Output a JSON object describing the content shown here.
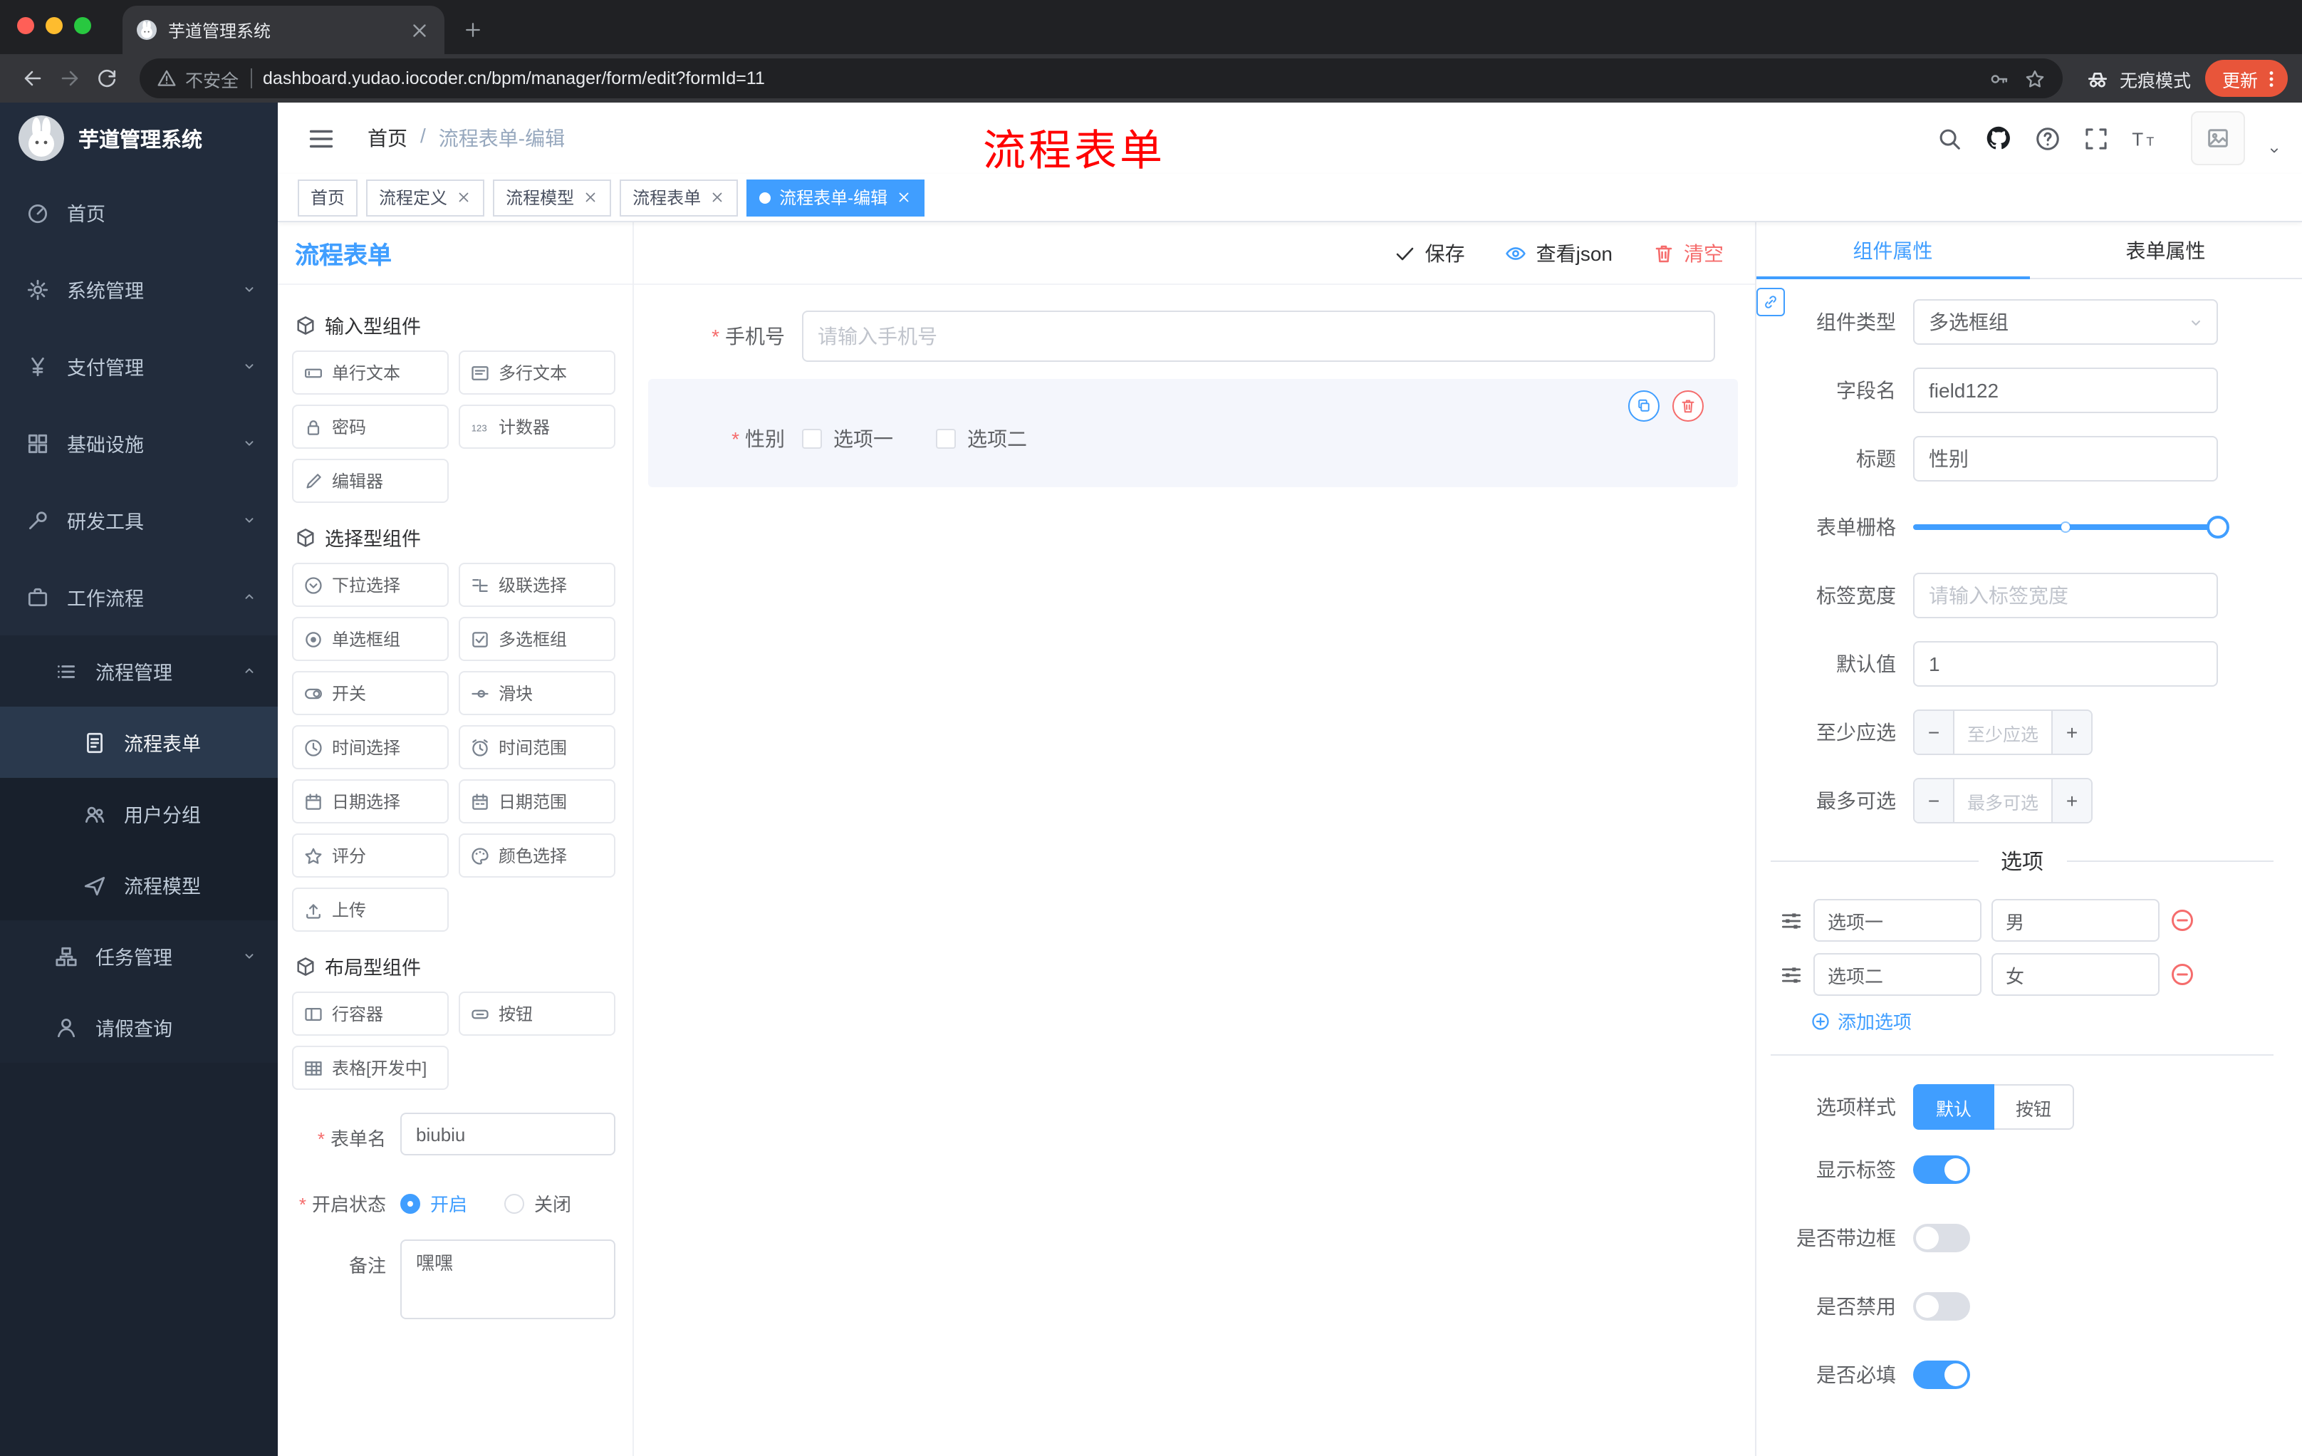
{
  "colors": {
    "accent": "#409eff",
    "danger": "#f56c6c",
    "annotation": "#ff0000",
    "update_pill": "#e8553a",
    "sidebar_bg": "#222c3c"
  },
  "browser": {
    "tab_title": "芋道管理系统",
    "url_security": "不安全",
    "url": "dashboard.yudao.iocoder.cn/bpm/manager/form/edit?formId=11",
    "incognito_label": "无痕模式",
    "update_label": "更新"
  },
  "sidebar": {
    "logo_title": "芋道管理系统",
    "items": [
      {
        "label": "首页",
        "icon": "home",
        "level": 1
      },
      {
        "label": "系统管理",
        "icon": "gear",
        "level": 1,
        "chevron": "down"
      },
      {
        "label": "支付管理",
        "icon": "yen",
        "level": 1,
        "chevron": "down"
      },
      {
        "label": "基础设施",
        "icon": "infra",
        "level": 1,
        "chevron": "down"
      },
      {
        "label": "研发工具",
        "icon": "tool",
        "level": 1,
        "chevron": "down"
      },
      {
        "label": "工作流程",
        "icon": "workflow",
        "level": 1,
        "chevron": "up"
      },
      {
        "label": "流程管理",
        "icon": "list",
        "level": 2,
        "chevron": "up"
      },
      {
        "label": "流程表单",
        "icon": "doc",
        "level": 3,
        "active": true
      },
      {
        "label": "用户分组",
        "icon": "users",
        "level": 3
      },
      {
        "label": "流程模型",
        "icon": "plane",
        "level": 3
      },
      {
        "label": "任务管理",
        "icon": "tasktree",
        "level": 2,
        "chevron": "down"
      },
      {
        "label": "请假查询",
        "icon": "person",
        "level": 2
      }
    ]
  },
  "header": {
    "breadcrumb_home": "首页",
    "breadcrumb_sep": "/",
    "breadcrumb_current": "流程表单-编辑",
    "annotation": "流程表单"
  },
  "tagbar": {
    "tags": [
      {
        "label": "首页"
      },
      {
        "label": "流程定义",
        "closable": true
      },
      {
        "label": "流程模型",
        "closable": true
      },
      {
        "label": "流程表单",
        "closable": true
      },
      {
        "label": "流程表单-编辑",
        "closable": true,
        "active": true
      }
    ]
  },
  "designer": {
    "title": "流程表单",
    "toolbar": {
      "save": "保存",
      "view_json": "查看json",
      "clear": "清空"
    },
    "palette": {
      "sections": [
        {
          "title": "输入型组件",
          "items": [
            {
              "label": "单行文本",
              "icon": "input-text"
            },
            {
              "label": "多行文本",
              "icon": "textarea"
            },
            {
              "label": "密码",
              "icon": "lock"
            },
            {
              "label": "计数器",
              "icon": "counter"
            },
            {
              "label": "编辑器",
              "icon": "editor"
            }
          ]
        },
        {
          "title": "选择型组件",
          "items": [
            {
              "label": "下拉选择",
              "icon": "select"
            },
            {
              "label": "级联选择",
              "icon": "cascade"
            },
            {
              "label": "单选框组",
              "icon": "radio"
            },
            {
              "label": "多选框组",
              "icon": "checkbox"
            },
            {
              "label": "开关",
              "icon": "switch"
            },
            {
              "label": "滑块",
              "icon": "slider"
            },
            {
              "label": "时间选择",
              "icon": "time"
            },
            {
              "label": "时间范围",
              "icon": "timerange"
            },
            {
              "label": "日期选择",
              "icon": "date"
            },
            {
              "label": "日期范围",
              "icon": "daterange"
            },
            {
              "label": "评分",
              "icon": "star"
            },
            {
              "label": "颜色选择",
              "icon": "color"
            },
            {
              "label": "上传",
              "icon": "upload"
            }
          ]
        },
        {
          "title": "布局型组件",
          "items": [
            {
              "label": "行容器",
              "icon": "row"
            },
            {
              "label": "按钮",
              "icon": "button"
            },
            {
              "label": "表格[开发中]",
              "icon": "table"
            }
          ]
        }
      ]
    },
    "meta_form": {
      "name_label": "表单名",
      "name_value": "biubiu",
      "status_label": "开启状态",
      "status_on": "开启",
      "status_off": "关闭",
      "remark_label": "备注",
      "remark_value": "嘿嘿"
    },
    "canvas": {
      "phone_label": "手机号",
      "phone_placeholder": "请输入手机号",
      "gender_label": "性别",
      "gender_options": [
        "选项一",
        "选项二"
      ]
    }
  },
  "panel": {
    "tabs": [
      "组件属性",
      "表单属性"
    ],
    "fields": {
      "type_label": "组件类型",
      "type_value": "多选框组",
      "field_label": "字段名",
      "field_value": "field122",
      "title_label": "标题",
      "title_value": "性别",
      "grid_label": "表单栅格",
      "label_width_label": "标签宽度",
      "label_width_placeholder": "请输入标签宽度",
      "default_label": "默认值",
      "default_value": "1",
      "min_label": "至少应选",
      "min_placeholder": "至少应选",
      "max_label": "最多可选",
      "max_placeholder": "最多可选"
    },
    "options": {
      "title": "选项",
      "rows": [
        {
          "name": "选项一",
          "value": "男"
        },
        {
          "name": "选项二",
          "value": "女"
        }
      ],
      "add_label": "添加选项"
    },
    "style": {
      "label": "选项样式",
      "choices": [
        "默认",
        "按钮"
      ],
      "active_index": 0
    },
    "switches": [
      {
        "label": "显示标签",
        "on": true
      },
      {
        "label": "是否带边框",
        "on": false
      },
      {
        "label": "是否禁用",
        "on": false
      },
      {
        "label": "是否必填",
        "on": true
      }
    ]
  }
}
